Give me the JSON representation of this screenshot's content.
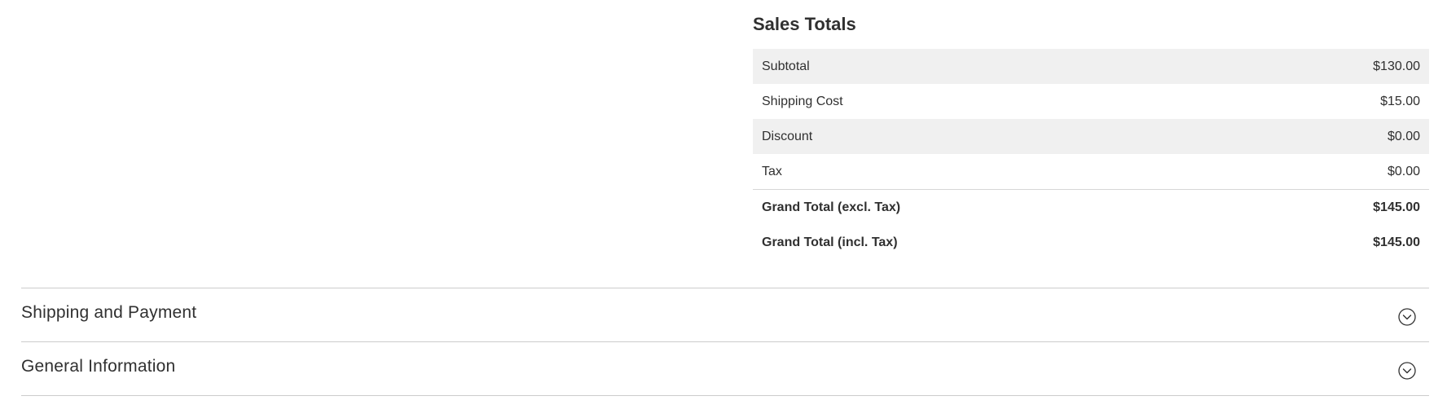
{
  "sales_totals": {
    "title": "Sales Totals",
    "rows": [
      {
        "label": "Subtotal",
        "amount": "$130.00"
      },
      {
        "label": "Shipping Cost",
        "amount": "$15.00"
      },
      {
        "label": "Discount",
        "amount": "$0.00"
      },
      {
        "label": "Tax",
        "amount": "$0.00"
      }
    ],
    "grand_totals": [
      {
        "label": "Grand Total (excl. Tax)",
        "amount": "$145.00"
      },
      {
        "label": "Grand Total (incl. Tax)",
        "amount": "$145.00"
      }
    ]
  },
  "sections": [
    {
      "title": "Shipping and Payment",
      "icon": "chevron-down-circle-icon",
      "expanded": false
    },
    {
      "title": "General Information",
      "icon": "chevron-down-circle-icon",
      "expanded": false
    }
  ],
  "colors": {
    "text": "#303030",
    "row_alt_background": "#f0f0f0",
    "divider": "#cccccc"
  }
}
